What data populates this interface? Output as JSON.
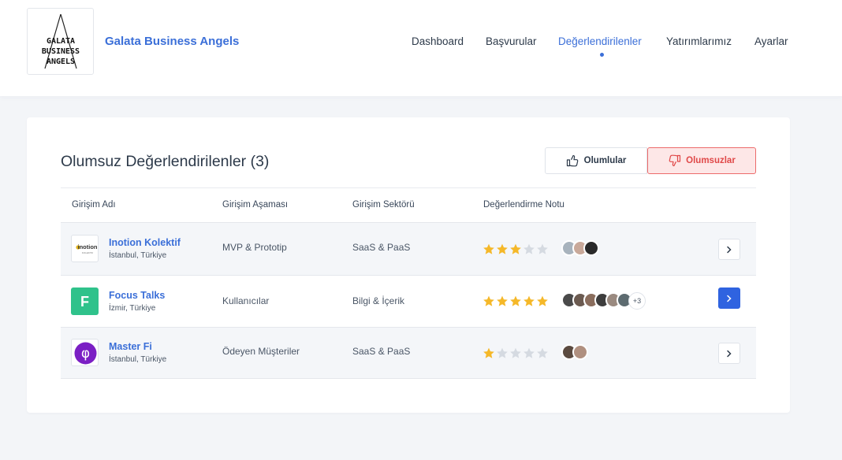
{
  "app": {
    "logo_lines": [
      "GALATA",
      "BUSINESS",
      "ANGELS"
    ],
    "brand": "Galata Business Angels"
  },
  "nav": [
    {
      "label": "Dashboard",
      "active": false
    },
    {
      "label": "Başvurular",
      "active": false
    },
    {
      "label": "Değerlendirilenler",
      "active": true
    },
    {
      "label": "Yatırımlarımız",
      "active": false
    },
    {
      "label": "Ayarlar",
      "active": false
    }
  ],
  "card": {
    "title": "Olumsuz Değerlendirilenler (3)",
    "toggle_positive": "Olumlular",
    "toggle_negative": "Olumsuzlar",
    "columns": [
      "Girişim Adı",
      "Girişim Aşaması",
      "Girişim Sektörü",
      "Değerlendirme Notu"
    ]
  },
  "rows": [
    {
      "logo_text": "inotion",
      "logo_subtext": "KOLEKTIF",
      "name": "Inotion Kolektif",
      "location": "İstanbul, Türkiye",
      "stage": "MVP & Prototip",
      "sector": "SaaS & PaaS",
      "rating": 3,
      "avatar_colors": [
        "#a8b3bd",
        "#c9a99a",
        "#2a2a2a"
      ],
      "more": ""
    },
    {
      "logo_text": "F",
      "name": "Focus Talks",
      "location": "İzmir, Türkiye",
      "stage": "Kullanıcılar",
      "sector": "Bilgi & İçerik",
      "rating": 5,
      "avatar_colors": [
        "#4a4a4a",
        "#6b5a50",
        "#8a6d5d",
        "#3d3d3d",
        "#9a8a80",
        "#5d6b70"
      ],
      "more": "+3"
    },
    {
      "logo_text": "φ",
      "name": "Master Fi",
      "location": "İstanbul, Türkiye",
      "stage": "Ödeyen Müşteriler",
      "sector": "SaaS & PaaS",
      "rating": 1,
      "avatar_colors": [
        "#5a4a40",
        "#b09080"
      ],
      "more": ""
    }
  ],
  "colors": {
    "accent": "#3b6fd8",
    "primary_button": "#2f63e0",
    "negative": "#e04848",
    "negative_bg": "#fde7e7",
    "star_on": "#f5b829",
    "star_off": "#d5dae1",
    "focus_green": "#2fc28b",
    "master_purple": "#7b1fc4"
  },
  "icons": {
    "thumbs_up": "thumbs-up-icon",
    "thumbs_down": "thumbs-down-icon",
    "chevron": "chevron-right-icon",
    "star": "star-icon"
  }
}
